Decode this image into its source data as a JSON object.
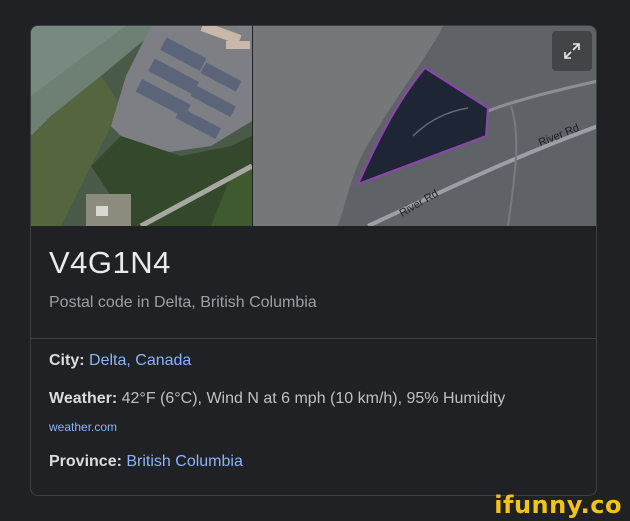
{
  "card": {
    "title": "V4G1N4",
    "subtitle": "Postal code in Delta, British Columbia",
    "map": {
      "road_labels": [
        "River Rd",
        "River Rd"
      ]
    },
    "city": {
      "label": "City:",
      "value": "Delta, Canada"
    },
    "weather": {
      "label": "Weather:",
      "value": "42°F (6°C), Wind N at 6 mph (10 km/h), 95% Humidity",
      "source": "weather.com"
    },
    "province": {
      "label": "Province:",
      "value": "British Columbia"
    }
  },
  "watermark": "ifunny.co",
  "icons": {
    "expand": "expand-arrows-icon"
  },
  "colors": {
    "background": "#202124",
    "link": "#8ab4f8",
    "region_fill": "#1e2535",
    "region_border": "#8e44ad"
  }
}
